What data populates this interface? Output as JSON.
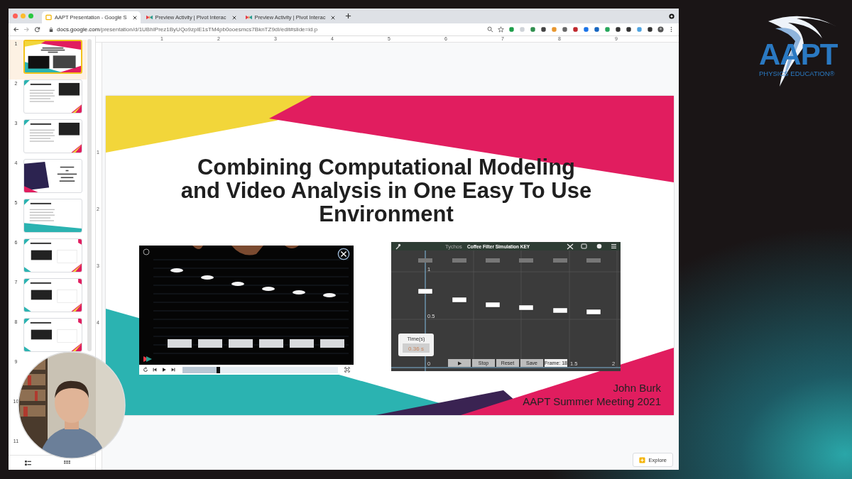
{
  "browser": {
    "tabs": [
      {
        "title": "AAPT Presentation - Google S",
        "kind": "slides",
        "selected": true
      },
      {
        "title": "Preview Activity | Pivot Interac",
        "kind": "pivot",
        "selected": false
      },
      {
        "title": "Preview Activity | Pivot Interac",
        "kind": "pivot",
        "selected": false
      }
    ],
    "url_host": "docs.google.com",
    "url_path": "/presentation/d/1UBhIPrez1ByUQo9zplE1sTM4pb0ooesmcs7BknTZ9dI/edit#slide=id.p"
  },
  "filmstrip": {
    "slides": [
      {
        "number": "1",
        "kind": "cover",
        "selected": true
      },
      {
        "number": "2",
        "kind": "bullets",
        "selected": false
      },
      {
        "number": "3",
        "kind": "bullets",
        "selected": false
      },
      {
        "number": "4",
        "kind": "section",
        "selected": false
      },
      {
        "number": "5",
        "kind": "list",
        "selected": false
      },
      {
        "number": "6",
        "kind": "part",
        "selected": false
      },
      {
        "number": "7",
        "kind": "part",
        "selected": false
      },
      {
        "number": "8",
        "kind": "part",
        "selected": false
      },
      {
        "number": "9",
        "kind": "hidden",
        "selected": false
      },
      {
        "number": "10",
        "kind": "hidden",
        "selected": false
      },
      {
        "number": "11",
        "kind": "hidden",
        "selected": false
      }
    ]
  },
  "rulers": {
    "horizontal": [
      "1",
      "2",
      "3",
      "4",
      "5",
      "6",
      "7",
      "8",
      "9"
    ],
    "vertical": [
      "1",
      "2",
      "3",
      "4"
    ]
  },
  "slide": {
    "title_lines": [
      "Combining Computational Modeling",
      "and Video Analysis in One Easy To Use",
      "Environment"
    ],
    "video_player": {
      "level": 0.22
    },
    "simulation": {
      "app": "Tychos",
      "title": "Coffee Filter Simulation KEY",
      "axis_labels": [
        "1",
        "0.5",
        "0",
        "1.5",
        "2"
      ],
      "timer_label": "Time(s)",
      "timer_value": "0.36 s",
      "buttons": [
        "▶",
        "Stop",
        "Reset",
        "Save",
        "Frame: 18"
      ]
    },
    "author": "John Burk",
    "event": "AAPT Summer Meeting 2021"
  },
  "explore_button": "Explore",
  "logo": {
    "name": "AAPT",
    "tagline": "PHYSICS EDUCATION®"
  }
}
